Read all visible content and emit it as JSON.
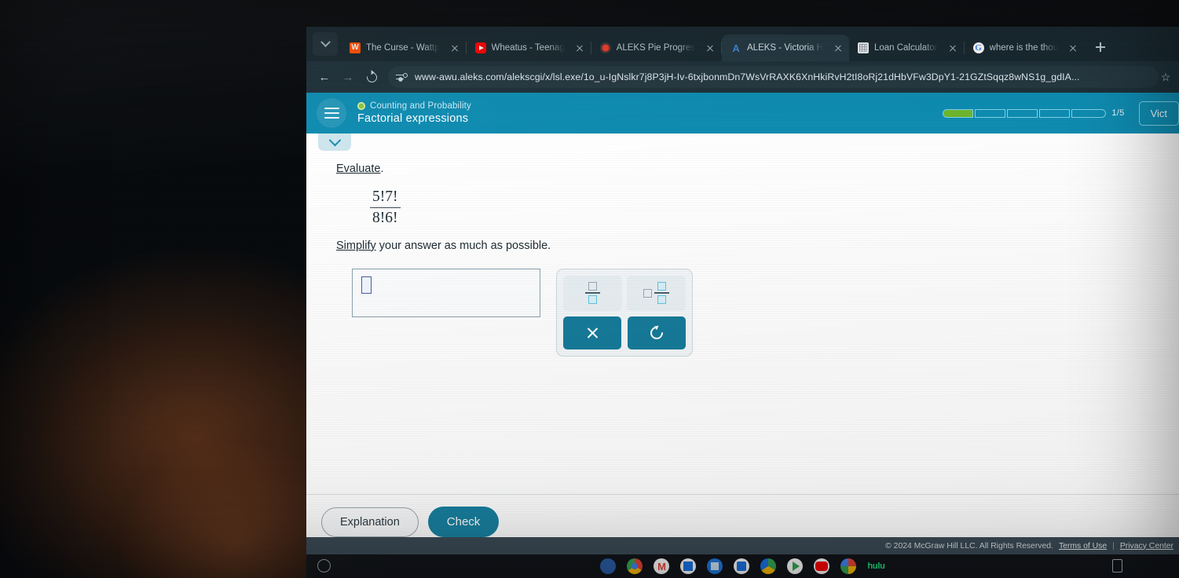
{
  "browser": {
    "tabs": [
      {
        "title": "The Curse - Wattp",
        "favicon": "wattpad-icon",
        "active": false
      },
      {
        "title": "Wheatus - Teenag",
        "favicon": "youtube-icon",
        "active": false
      },
      {
        "title": "ALEKS Pie Progres",
        "favicon": "aleks-icon",
        "active": false
      },
      {
        "title": "ALEKS - Victoria H",
        "favicon": "aleks-a-icon",
        "active": true
      },
      {
        "title": "Loan Calculator",
        "favicon": "calculator-icon",
        "active": false
      },
      {
        "title": "where is the thou",
        "favicon": "google-icon",
        "active": false
      }
    ],
    "tab_close_label": "×",
    "new_tab_label": "+",
    "tab_list_chevron": "chevron-down-icon",
    "nav": {
      "back": "←",
      "forward": "→",
      "reload": "reload-icon"
    },
    "omnibox": {
      "site_settings_icon": "site-settings-icon",
      "url": "www-awu.aleks.com/alekscgi/x/lsl.exe/1o_u-IgNslkr7j8P3jH-Iv-6txjbonmDn7WsVrRAXK6XnHkiRvH2tI8oRj21dHbVFw3DpY1-21GZtSqqz8wNS1g_gdIA...",
      "bookmark_icon": "star-icon"
    }
  },
  "aleks": {
    "menu_icon": "hamburger-menu-icon",
    "topic": "Counting and Probability",
    "topic_status_icon": "green-circle-icon",
    "lesson_title": "Factorial expressions",
    "progress": {
      "segments": 5,
      "filled": 1,
      "label": "1/5",
      "fill_color": "#6cb52d"
    },
    "user_button": "Vict",
    "collapse_icon": "chevron-down-icon",
    "question": {
      "instruction_link": "Evaluate",
      "instruction_suffix": ".",
      "expression": {
        "numerator": "5!7!",
        "denominator": "8!6!"
      },
      "simplify_link": "Simplify",
      "simplify_text": " your answer as much as possible."
    },
    "answer": {
      "value": "",
      "placeholder_box": "empty-answer-placeholder"
    },
    "mathpad": {
      "fraction_button": "fraction-template",
      "mixed_number_button": "mixed-number-template",
      "clear_button": "×",
      "undo_button": "undo-icon"
    },
    "actions": {
      "explanation": "Explanation",
      "check": "Check"
    },
    "footer": {
      "copyright": "© 2024 McGraw Hill LLC. All Rights Reserved.",
      "terms": "Terms of Use",
      "separator": "|",
      "privacy": "Privacy Center"
    }
  },
  "shelf": {
    "launcher_icon": "launcher-icon",
    "items": [
      "files-icon",
      "chrome-icon",
      "gmail-icon",
      "sheets-icon",
      "slides-icon",
      "docs-icon",
      "drive-icon",
      "play-icon",
      "youtube-icon",
      "photos-icon"
    ],
    "hulu_label": "hulu",
    "status_icon": "battery-icon"
  },
  "colors": {
    "aleks_header": "#0e8bb0",
    "accent_button": "#17809f",
    "progress_fill": "#6cb52d"
  }
}
